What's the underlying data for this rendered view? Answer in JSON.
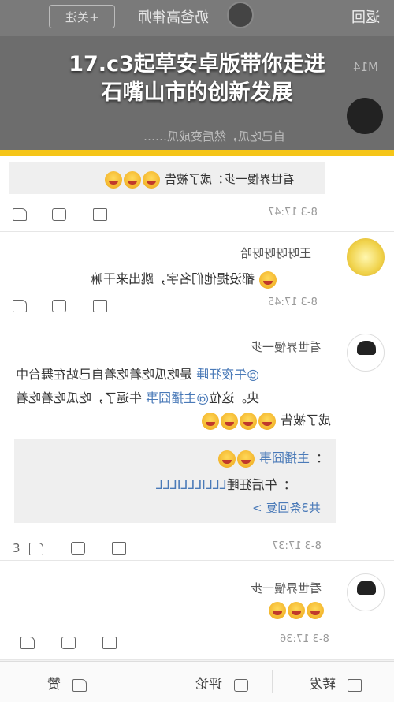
{
  "header": {
    "back_label": "返回",
    "author_name": "奶爸高律师",
    "follow_label": "+关注",
    "faded_line1": "M14",
    "faded_line2": "自己吃瓜，然后变成瓜……"
  },
  "banner": {
    "line1": "17.c3起草安卓版带你走进",
    "line2": "石嘴山市的创新发展"
  },
  "comments": [
    {
      "quote_text": "看世界慢一步：成了被告",
      "time": "8-3 17:47"
    },
    {
      "name": "王呀呀呀呀哈",
      "text": "都没提他们名字，跳出来干嘛",
      "time": "8-3 17:45"
    },
    {
      "name": "看世界慢一步",
      "line1_prefix": "@",
      "line1_mention": "午夜狂睡",
      "line1_rest": " 是吃瓜吃着吃着自己站在舞台中",
      "line2_pre": "央。这位",
      "line2_mention": "@主播囧事",
      "line2_rest": " 牛逼了，吃瓜吃着吃着",
      "line3": "成了被告",
      "replies": {
        "reply1_name": "主播囧事",
        "reply1_suffix": "：",
        "reply2_name": "LLLILLLILLL",
        "reply2_text": "：午后狂睡",
        "more_label": "共3条回复 >"
      },
      "like_count": "3",
      "time": "8-3 17:37"
    },
    {
      "name": "看世界慢一步",
      "time": "8-3 17:36"
    }
  ],
  "bottom_bar": {
    "share_label": "转发",
    "comment_label": "评论",
    "like_label": "赞"
  },
  "colors": {
    "accent_yellow": "#f5c518",
    "mention_blue": "#4a7ab8"
  }
}
